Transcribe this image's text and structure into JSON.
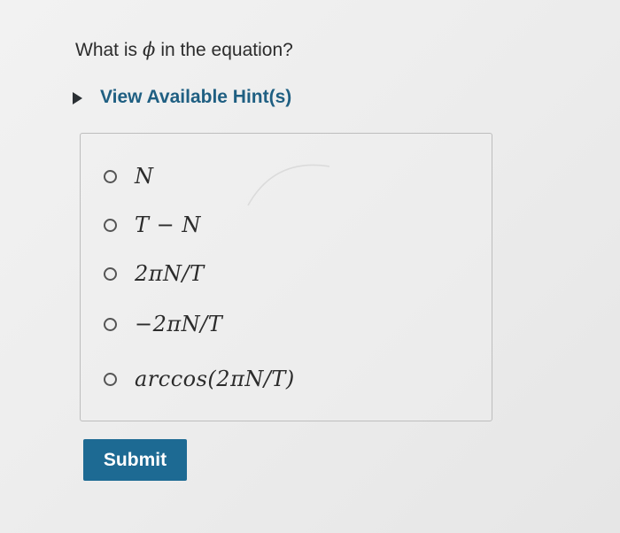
{
  "question": {
    "prefix": "What is",
    "variable": "ϕ",
    "suffix": "in the equation?"
  },
  "hint": {
    "label": "View Available Hint(s)",
    "icon": "caret-right-icon",
    "expanded": false
  },
  "options": [
    {
      "label": "N",
      "selected": false
    },
    {
      "label": "T − N",
      "selected": false
    },
    {
      "label": "2πN/T",
      "selected": false
    },
    {
      "label": "−2πN/T",
      "selected": false
    },
    {
      "label": "arccos(2πN/T)",
      "selected": false
    }
  ],
  "submit": {
    "label": "Submit"
  },
  "colors": {
    "accent": "#1d6a93",
    "hint_text": "#1f5f82",
    "background": "#efefef"
  }
}
